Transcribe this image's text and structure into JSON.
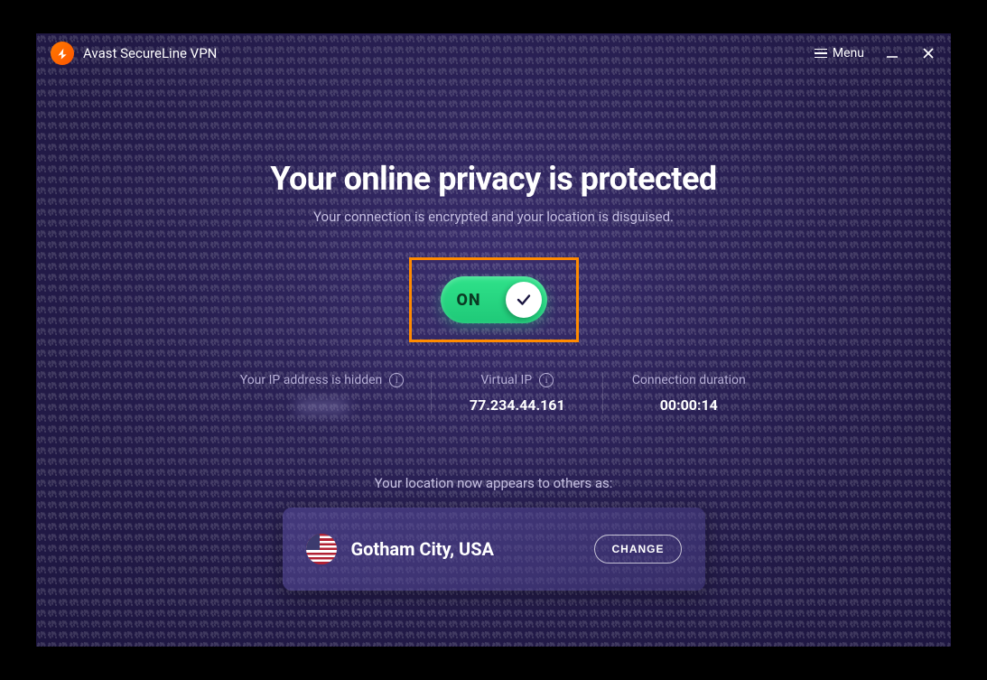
{
  "titlebar": {
    "app_title": "Avast SecureLine VPN",
    "menu_label": "Menu"
  },
  "main": {
    "headline": "Your online privacy is protected",
    "subhead": "Your connection is encrypted and your location is disguised.",
    "toggle_label": "ON"
  },
  "stats": {
    "ip_hidden_label": "Your IP address is hidden",
    "ip_hidden_value": "••••••••",
    "virtual_ip_label": "Virtual IP",
    "virtual_ip_value": "77.234.44.161",
    "duration_label": "Connection duration",
    "duration_value": "00:00:14"
  },
  "location": {
    "caption": "Your location now appears to others as:",
    "name": "Gotham City, USA",
    "change_label": "CHANGE"
  }
}
